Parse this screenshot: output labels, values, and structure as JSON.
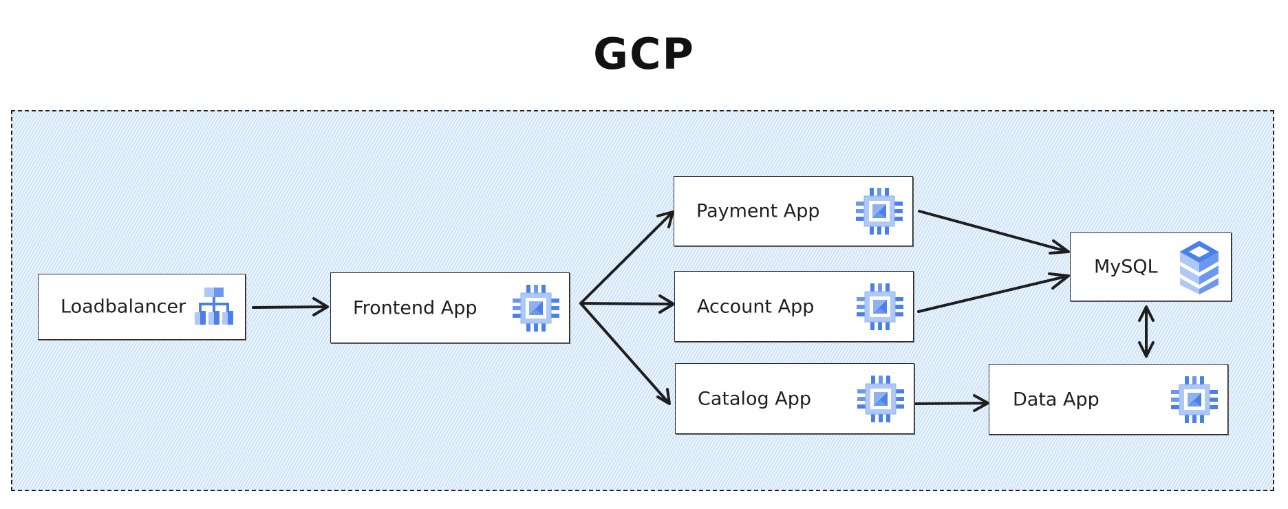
{
  "title": "GCP",
  "container": {
    "label": "GCP"
  },
  "colors": {
    "accent_dark": "#4a80e8",
    "accent_light": "#aec8f7",
    "region_fill": "#eaf3fc"
  },
  "nodes": [
    {
      "id": "loadbalancer",
      "label": "Loadbalancer",
      "icon": "load-balancer-icon"
    },
    {
      "id": "frontend",
      "label": "Frontend App",
      "icon": "compute-chip-icon"
    },
    {
      "id": "payment",
      "label": "Payment App",
      "icon": "compute-chip-icon"
    },
    {
      "id": "account",
      "label": "Account App",
      "icon": "compute-chip-icon"
    },
    {
      "id": "catalog",
      "label": "Catalog App",
      "icon": "compute-chip-icon"
    },
    {
      "id": "mysql",
      "label": "MySQL",
      "icon": "database-icon"
    },
    {
      "id": "data",
      "label": "Data App",
      "icon": "compute-chip-icon"
    }
  ],
  "edges": [
    {
      "from": "loadbalancer",
      "to": "frontend",
      "direction": "forward"
    },
    {
      "from": "frontend",
      "to": "payment",
      "direction": "forward"
    },
    {
      "from": "frontend",
      "to": "account",
      "direction": "forward"
    },
    {
      "from": "frontend",
      "to": "catalog",
      "direction": "forward"
    },
    {
      "from": "payment",
      "to": "mysql",
      "direction": "forward"
    },
    {
      "from": "account",
      "to": "mysql",
      "direction": "forward"
    },
    {
      "from": "catalog",
      "to": "data",
      "direction": "forward"
    },
    {
      "from": "mysql",
      "to": "data",
      "direction": "both"
    }
  ]
}
